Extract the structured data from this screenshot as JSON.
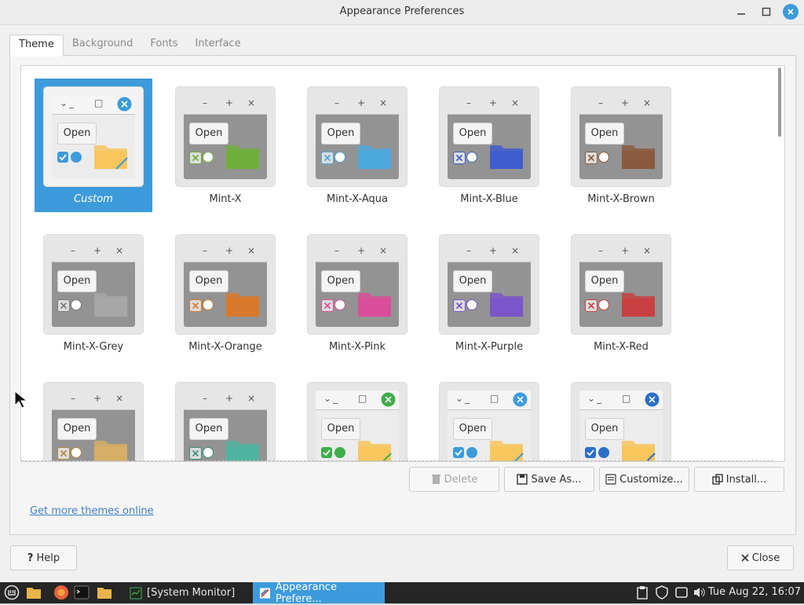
{
  "window": {
    "title": "Appearance Preferences"
  },
  "tabs": [
    {
      "label": "Theme",
      "active": true
    },
    {
      "label": "Background",
      "active": false
    },
    {
      "label": "Fonts",
      "active": false
    },
    {
      "label": "Interface",
      "active": false
    }
  ],
  "preview": {
    "open_label": "Open"
  },
  "themes": [
    {
      "name": "Custom",
      "selected": true,
      "style": "light-blue",
      "folder": "#f7c65d",
      "accent": "#3d9bdc"
    },
    {
      "name": "Mint-X",
      "style": "mint",
      "folder": "#6fae3a",
      "accent": "#6fae3a"
    },
    {
      "name": "Mint-X-Aqua",
      "style": "mint",
      "folder": "#4da8dd",
      "accent": "#4da8dd"
    },
    {
      "name": "Mint-X-Blue",
      "style": "mint",
      "folder": "#3f5ccc",
      "accent": "#3f5ccc"
    },
    {
      "name": "Mint-X-Brown",
      "style": "mint",
      "folder": "#8b5a3c",
      "accent": "#8b5a3c"
    },
    {
      "name": "Mint-X-Grey",
      "style": "mint",
      "folder": "#a7a7a7",
      "accent": "#7a7a7a"
    },
    {
      "name": "Mint-X-Orange",
      "style": "mint",
      "folder": "#d9782a",
      "accent": "#d9782a"
    },
    {
      "name": "Mint-X-Pink",
      "style": "mint",
      "folder": "#d94e9a",
      "accent": "#d94e9a"
    },
    {
      "name": "Mint-X-Purple",
      "style": "mint",
      "folder": "#7b55cc",
      "accent": "#7b55cc"
    },
    {
      "name": "Mint-X-Red",
      "style": "mint",
      "folder": "#c84040",
      "accent": "#c84040"
    },
    {
      "name": "",
      "style": "mint",
      "folder": "#d7ae63",
      "accent": "#b58a3c"
    },
    {
      "name": "",
      "style": "mint",
      "folder": "#4fb3a0",
      "accent": "#3a8f7f"
    },
    {
      "name": "",
      "style": "light-green",
      "folder": "#f7c65d",
      "accent": "#3fae4a"
    },
    {
      "name": "",
      "style": "light-blue",
      "folder": "#f7c65d",
      "accent": "#3d9bdc"
    },
    {
      "name": "",
      "style": "light-darkblue",
      "folder": "#f7c65d",
      "accent": "#2a6fc7"
    }
  ],
  "actions": {
    "delete": "Delete",
    "save_as": "Save As...",
    "customize": "Customize...",
    "install": "Install..."
  },
  "more_link": "Get more themes online",
  "footer": {
    "help": "Help",
    "close": "Close"
  },
  "taskbar": {
    "windows": [
      {
        "label": "[System Monitor]",
        "active": false
      },
      {
        "label": "Appearance Prefere...",
        "active": true
      }
    ],
    "clock": "Tue Aug 22, 16:07"
  },
  "colors": {
    "accent": "#3d9bdc",
    "taskbar": "#262626",
    "link": "#3d7fc3"
  }
}
